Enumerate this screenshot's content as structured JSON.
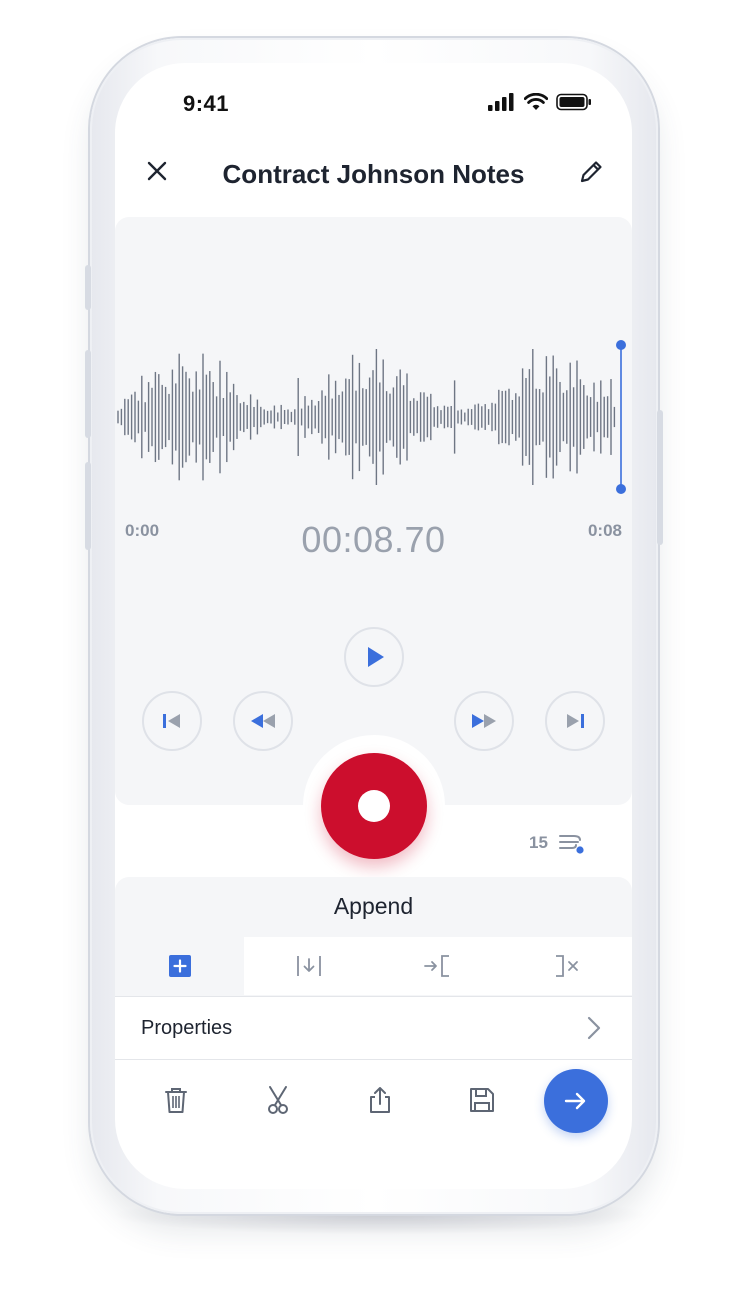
{
  "status_bar": {
    "time": "9:41"
  },
  "header": {
    "title": "Contract Johnson Notes"
  },
  "player": {
    "start_time": "0:00",
    "end_time": "0:08",
    "current_time": "00:08.70",
    "speed_value": "15"
  },
  "mode": {
    "label": "Append",
    "tabs": [
      {
        "icon": "plus-square-icon",
        "active": true
      },
      {
        "icon": "insert-icon",
        "active": false
      },
      {
        "icon": "overwrite-icon",
        "active": false
      },
      {
        "icon": "cut-to-end-icon",
        "active": false
      }
    ]
  },
  "properties": {
    "label": "Properties"
  },
  "colors": {
    "accent": "#3b6fdc",
    "record": "#cc0e2d",
    "waveform": "#6e7684",
    "panel": "#f5f6f8"
  }
}
